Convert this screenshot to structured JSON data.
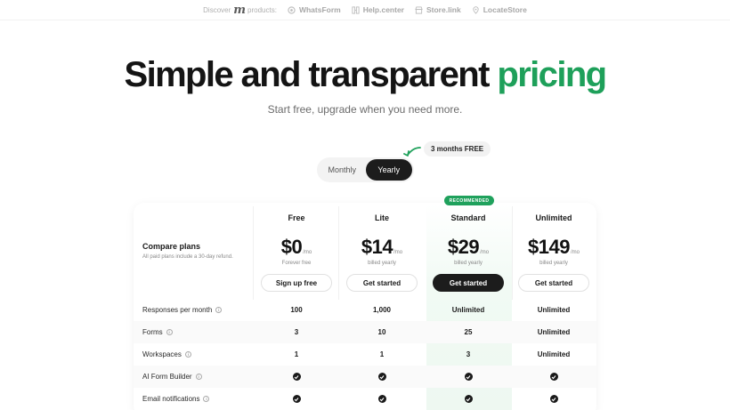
{
  "topbar": {
    "discover_label": "Discover",
    "products_label": "products:",
    "brand_mark": "m",
    "products": [
      {
        "name": "WhatsForm",
        "icon": "whatsform-icon"
      },
      {
        "name": "Help.center",
        "icon": "help-center-icon"
      },
      {
        "name": "Store.link",
        "icon": "store-link-icon"
      },
      {
        "name": "LocateStore",
        "icon": "locate-store-icon"
      }
    ]
  },
  "hero": {
    "title_main": "Simple and transparent ",
    "title_accent": "pricing",
    "subtitle": "Start free, upgrade when you need more.",
    "accent_color": "#1ea05a"
  },
  "billing_toggle": {
    "options": [
      "Monthly",
      "Yearly"
    ],
    "selected": "Yearly",
    "promo": "3 months FREE"
  },
  "compare": {
    "title": "Compare plans",
    "note": "All paid plans include a 30-day refund."
  },
  "recommended_badge": "RECOMMENDED",
  "plans": [
    {
      "name": "Free",
      "price": "$0",
      "unit": "/mo",
      "billing": "Forever free",
      "cta": "Sign up free"
    },
    {
      "name": "Lite",
      "price": "$14",
      "unit": "/mo",
      "billing": "billed yearly",
      "cta": "Get started"
    },
    {
      "name": "Standard",
      "price": "$29",
      "unit": "/mo",
      "billing": "billed yearly",
      "cta": "Get started"
    },
    {
      "name": "Unlimited",
      "price": "$149",
      "unit": "/mo",
      "billing": "billed yearly",
      "cta": "Get started"
    }
  ],
  "features": [
    {
      "name": "Responses per month",
      "values": [
        "100",
        "1,000",
        "Unlimited",
        "Unlimited"
      ]
    },
    {
      "name": "Forms",
      "values": [
        "3",
        "10",
        "25",
        "Unlimited"
      ]
    },
    {
      "name": "Workspaces",
      "values": [
        "1",
        "1",
        "3",
        "Unlimited"
      ]
    },
    {
      "name": "AI Form Builder",
      "values": [
        "check",
        "check",
        "check",
        "check"
      ]
    },
    {
      "name": "Email notifications",
      "values": [
        "check",
        "check",
        "check",
        "check"
      ]
    }
  ]
}
